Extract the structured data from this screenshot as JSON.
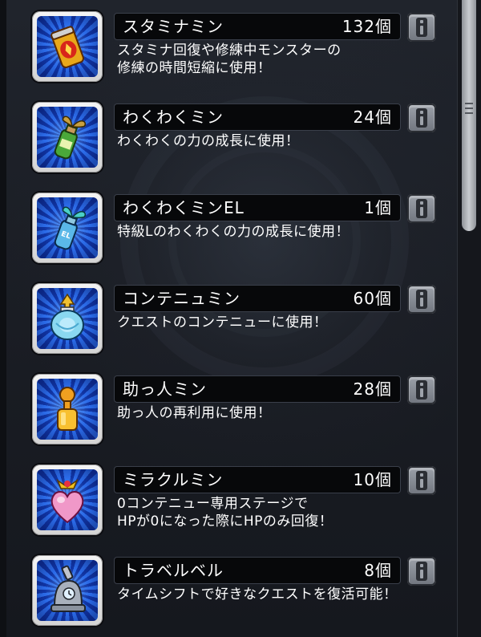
{
  "items": [
    {
      "name": "スタミナミン",
      "count": "132個",
      "desc": "スタミナ回復や修練中モンスターの\n修練の時間短縮に使用！",
      "icon": "stamina-can-icon"
    },
    {
      "name": "わくわくミン",
      "count": "24個",
      "desc": "わくわくの力の成長に使用！",
      "icon": "green-sprout-bottle-icon"
    },
    {
      "name": "わくわくミンEL",
      "count": "1個",
      "desc": "特級Lのわくわくの力の成長に使用！",
      "icon": "blue-sprout-bottle-icon",
      "icon_label": "EL"
    },
    {
      "name": "コンテニュミン",
      "count": "60個",
      "desc": "クエストのコンテニューに使用！",
      "icon": "continue-jar-icon"
    },
    {
      "name": "助っ人ミン",
      "count": "28個",
      "desc": "助っ人の再利用に使用！",
      "icon": "helper-bottle-icon"
    },
    {
      "name": "ミラクルミン",
      "count": "10個",
      "desc": "0コンテニュー専用ステージで\nHPが0になった際にHPのみ回復！",
      "icon": "pink-heart-bottle-icon"
    },
    {
      "name": "トラベルベル",
      "count": "8個",
      "desc": "タイムシフトで好きなクエストを復活可能！",
      "icon": "travel-bell-icon"
    }
  ],
  "info_icon": "info-i-icon",
  "colors": {
    "card_bg": "#07080a",
    "item_bg_blue": "#2b6be8",
    "text": "#ffffff"
  }
}
